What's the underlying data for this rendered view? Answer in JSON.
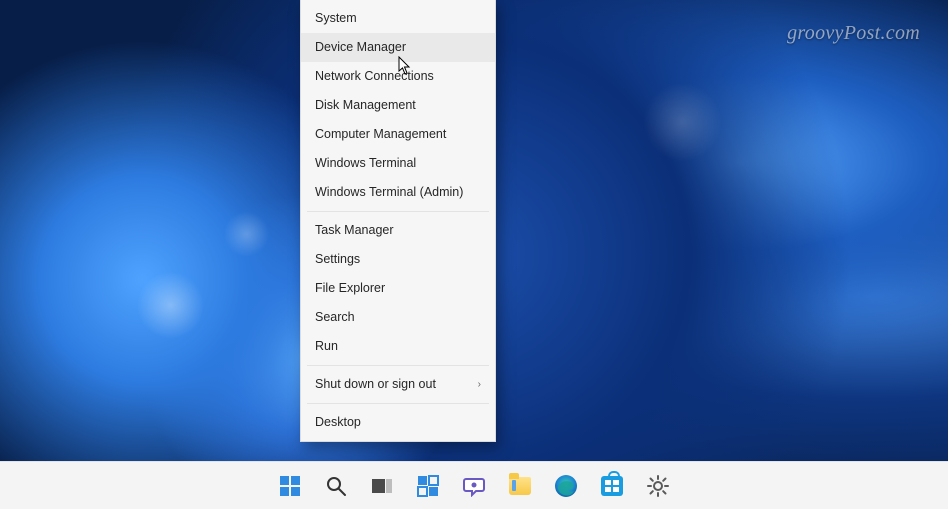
{
  "watermark": "groovyPost.com",
  "contextMenu": {
    "groups": [
      [
        {
          "label": "System",
          "submenu": false,
          "hover": false
        },
        {
          "label": "Device Manager",
          "submenu": false,
          "hover": true
        },
        {
          "label": "Network Connections",
          "submenu": false,
          "hover": false
        },
        {
          "label": "Disk Management",
          "submenu": false,
          "hover": false
        },
        {
          "label": "Computer Management",
          "submenu": false,
          "hover": false
        },
        {
          "label": "Windows Terminal",
          "submenu": false,
          "hover": false
        },
        {
          "label": "Windows Terminal (Admin)",
          "submenu": false,
          "hover": false
        }
      ],
      [
        {
          "label": "Task Manager",
          "submenu": false,
          "hover": false
        },
        {
          "label": "Settings",
          "submenu": false,
          "hover": false
        },
        {
          "label": "File Explorer",
          "submenu": false,
          "hover": false
        },
        {
          "label": "Search",
          "submenu": false,
          "hover": false
        },
        {
          "label": "Run",
          "submenu": false,
          "hover": false
        }
      ],
      [
        {
          "label": "Shut down or sign out",
          "submenu": true,
          "hover": false
        }
      ],
      [
        {
          "label": "Desktop",
          "submenu": false,
          "hover": false
        }
      ]
    ]
  },
  "taskbar": {
    "items": [
      {
        "name": "start-button",
        "icon": "start"
      },
      {
        "name": "search-button",
        "icon": "search"
      },
      {
        "name": "task-view-button",
        "icon": "taskview"
      },
      {
        "name": "widgets-button",
        "icon": "widgets"
      },
      {
        "name": "chat-button",
        "icon": "chat"
      },
      {
        "name": "file-explorer-button",
        "icon": "folder"
      },
      {
        "name": "edge-button",
        "icon": "edge"
      },
      {
        "name": "store-button",
        "icon": "store"
      },
      {
        "name": "settings-button",
        "icon": "gear"
      }
    ]
  }
}
